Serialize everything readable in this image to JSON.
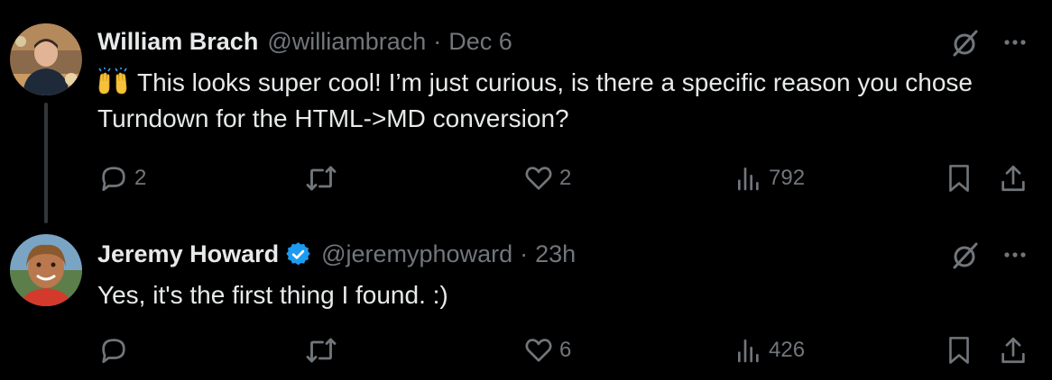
{
  "tweets": [
    {
      "author_name": "William Brach",
      "verified": false,
      "handle": "@williambrach",
      "separator": "·",
      "time": "Dec 6",
      "emoji_icon": "raising-hands-emoji",
      "text": "This looks super cool! I’m just curious, is there a specific reason you chose Turndown for the HTML->MD conversion?",
      "replies": "2",
      "reposts": "",
      "likes": "2",
      "views": "792"
    },
    {
      "author_name": "Jeremy Howard",
      "verified": true,
      "handle": "@jeremyphoward",
      "separator": "·",
      "time": "23h",
      "text": "Yes, it's the first thing I found. :)",
      "replies": "",
      "reposts": "",
      "likes": "6",
      "views": "426"
    }
  ],
  "colors": {
    "background": "#000000",
    "primary_text": "#e7e9ea",
    "secondary_text": "#71767b",
    "verified_badge": "#1d9bf0",
    "thread_line": "#333639"
  },
  "icons": {
    "reply": "reply-icon",
    "repost": "repost-icon",
    "like": "heart-icon",
    "views": "views-icon",
    "bookmark": "bookmark-icon",
    "share": "share-icon",
    "grok": "grok-icon",
    "more": "more-icon",
    "verified": "verified-badge-icon"
  }
}
